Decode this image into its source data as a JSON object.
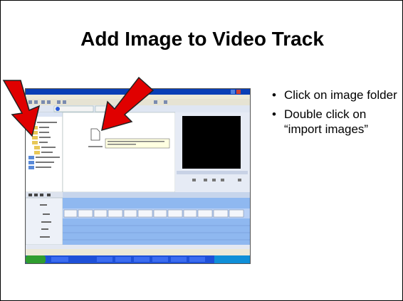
{
  "slide": {
    "title": "Add Image to Video Track",
    "bullets": [
      "Click on image folder",
      "Double click on “import images”"
    ]
  },
  "screenshot": {
    "description_icon": "windows-movie-maker-screenshot",
    "colors": {
      "titlebar": "#0a3fb6",
      "taskbar": "#1e50d8",
      "start": "#2f9d2f",
      "timeline": "#8fb8f0",
      "arrow": "#e00000"
    }
  }
}
